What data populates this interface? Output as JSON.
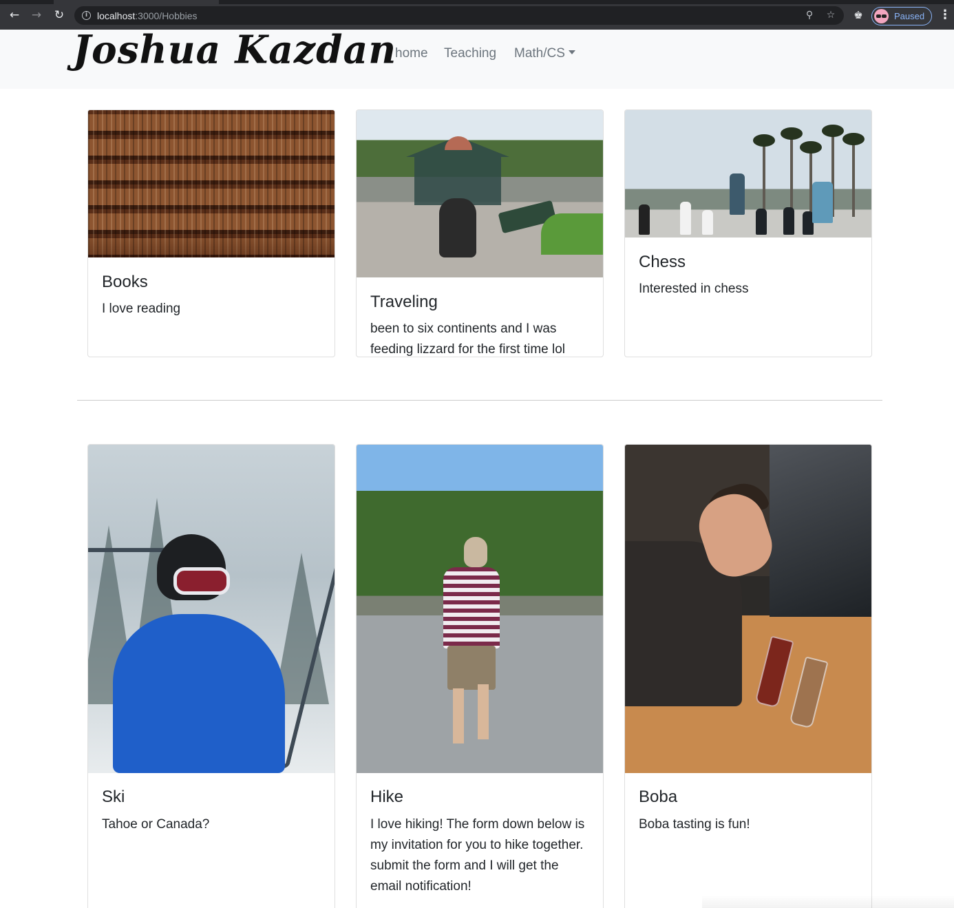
{
  "browser": {
    "url_host": "localhost",
    "url_path": ":3000/Hobbies",
    "profile_status": "Paused",
    "icons": [
      "back-icon",
      "forward-icon",
      "reload-icon",
      "info-icon",
      "zoom-icon",
      "star-icon",
      "extensions-icon",
      "menu-icon"
    ],
    "accent_color": "#8ab4f8"
  },
  "navbar": {
    "brand": "Joshua Kazdan",
    "links": {
      "home": "home",
      "teaching": "Teaching",
      "math_cs": "Math/CS"
    }
  },
  "cards": [
    {
      "title": "Books",
      "text": "I love reading"
    },
    {
      "title": "Traveling",
      "text": "been to six continents and I was feeding lizzard for the first time lol"
    },
    {
      "title": "Chess",
      "text": "Interested in chess"
    },
    {
      "title": "Ski",
      "text": "Tahoe or Canada?"
    },
    {
      "title": "Hike",
      "text": "I love hiking! The form down below is my invitation for you to hike together. submit the form and I will get the email notification!"
    },
    {
      "title": "Boba",
      "text": "Boba tasting is fun!"
    }
  ]
}
